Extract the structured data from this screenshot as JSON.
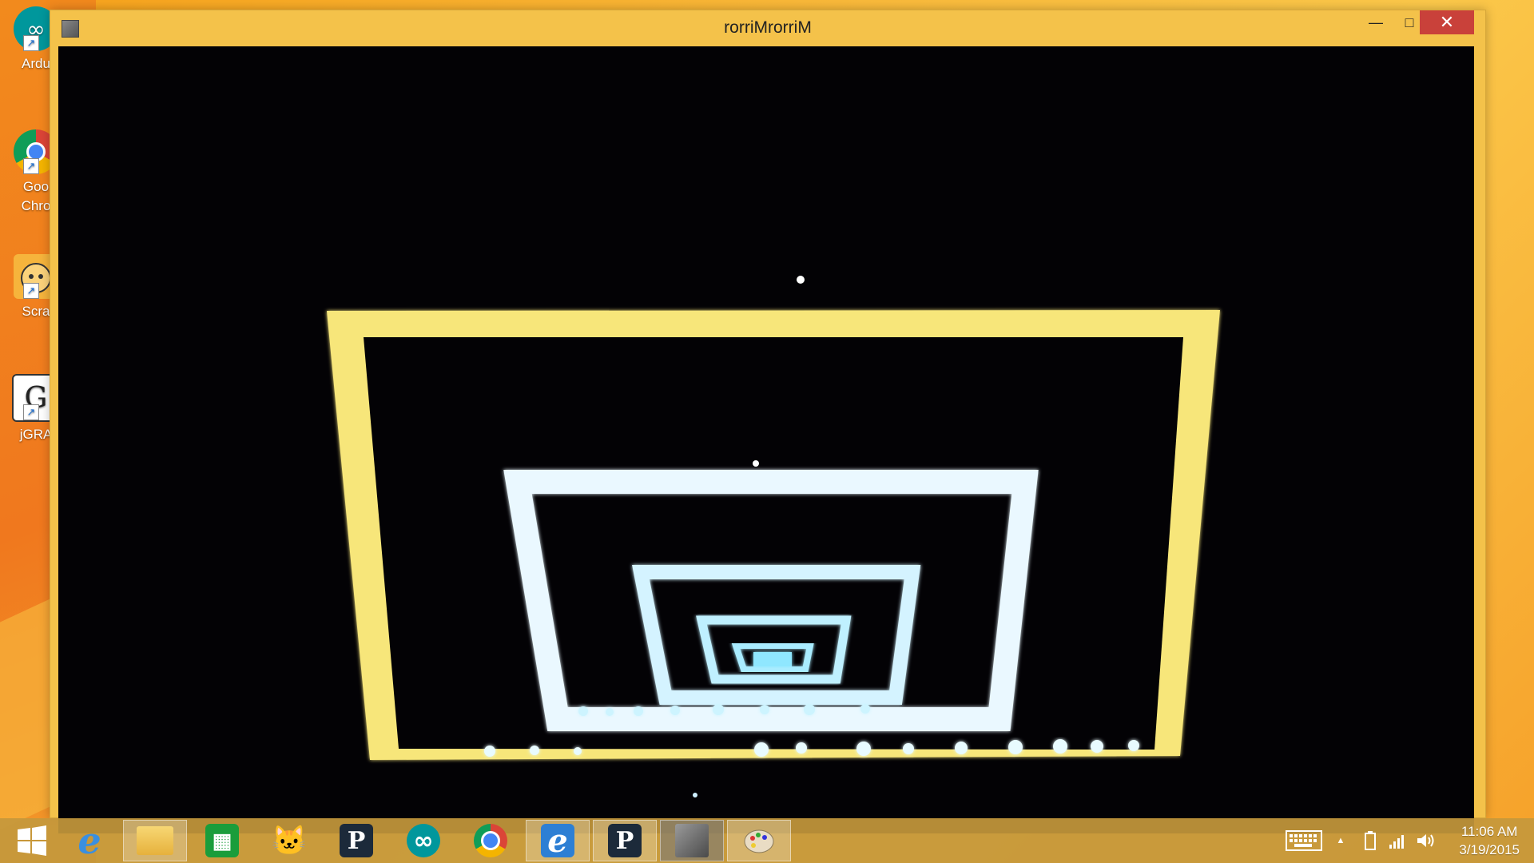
{
  "colors": {
    "frame_yellow": "#f7e67a",
    "line_cyan": "#dff6ff",
    "screen_black": "#030205",
    "close_red": "#c9413a"
  },
  "desktop": {
    "icons": [
      {
        "label_line1": "Ardu",
        "label_line2": "",
        "icon": "arduino-icon"
      },
      {
        "label_line1": "Goo",
        "label_line2": "Chro",
        "icon": "chrome-icon"
      },
      {
        "label_line1": "Scra",
        "label_line2": "",
        "icon": "scratch-icon"
      },
      {
        "label_line1": "jGRA",
        "label_line2": "",
        "icon": "jgrasp-icon"
      }
    ]
  },
  "window": {
    "title": "rorriMrorriM",
    "minimize_glyph": "—",
    "maximize_glyph": "□",
    "close_glyph": "✕"
  },
  "taskbar": {
    "items": [
      {
        "name": "windows-start",
        "icon": "windows-logo-icon"
      },
      {
        "name": "internet-explorer",
        "icon": "internet-explorer-icon"
      },
      {
        "name": "file-explorer",
        "icon": "folder-icon"
      },
      {
        "name": "store",
        "icon": "store-icon"
      },
      {
        "name": "scratch",
        "icon": "scratch-icon",
        "glyph": "🐱"
      },
      {
        "name": "processing",
        "icon": "processing-icon",
        "glyph": "P"
      },
      {
        "name": "arduino",
        "icon": "arduino-icon"
      },
      {
        "name": "chrome",
        "icon": "chrome-icon"
      },
      {
        "name": "internet-explorer-2",
        "icon": "internet-explorer-icon"
      },
      {
        "name": "processing-2",
        "icon": "processing-icon",
        "glyph": "P"
      },
      {
        "name": "mirror-app",
        "icon": "app-window-icon"
      },
      {
        "name": "paint",
        "icon": "paint-palette-icon"
      }
    ],
    "tray": {
      "keyboard_icon": "keyboard-icon",
      "chevron_glyph": "▲",
      "battery_icon": "battery-icon",
      "signal_icon": "signal-bars-icon",
      "volume_icon": "speaker-icon"
    },
    "clock": {
      "time": "11:06 AM",
      "date": "3/19/2015"
    }
  }
}
